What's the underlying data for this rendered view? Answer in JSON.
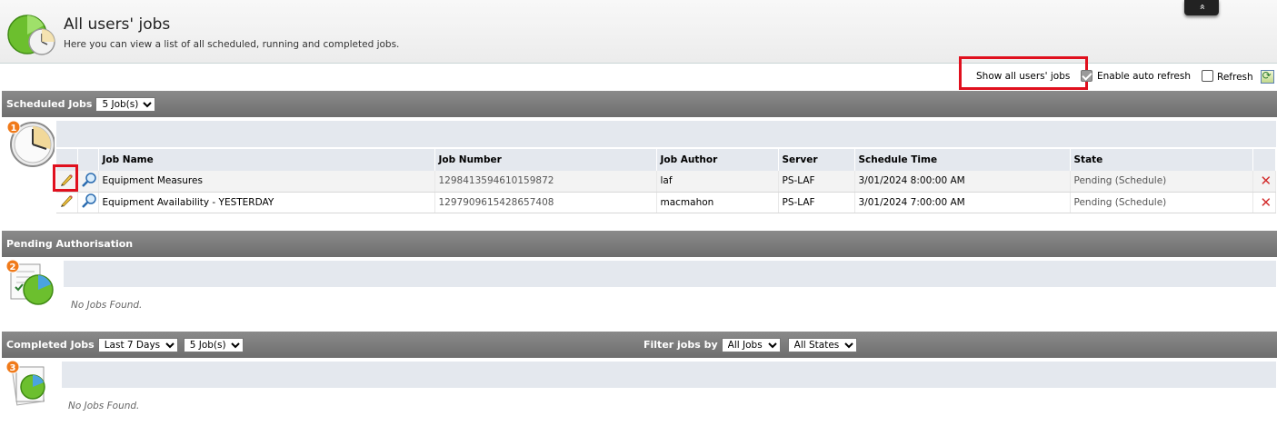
{
  "header": {
    "title": "All users' jobs",
    "subtitle": "Here you can view a list of all scheduled, running and completed jobs.",
    "collapse_label": "»"
  },
  "options": {
    "show_all_label": "Show all users' jobs",
    "show_all_checked": true,
    "auto_refresh_label": "Enable auto refresh",
    "auto_refresh_checked": false,
    "refresh_label": "Refresh"
  },
  "scheduled": {
    "title": "Scheduled Jobs",
    "count_select": "5 Job(s)",
    "badge": "1",
    "columns": [
      "Job Name",
      "Job Number",
      "Job Author",
      "Server",
      "Schedule Time",
      "State"
    ],
    "rows": [
      {
        "name": "Equipment Measures",
        "number": "1298413594610159872",
        "author": "laf",
        "server": "PS-LAF",
        "time": "3/01/2024 8:00:00 AM",
        "state": "Pending (Schedule)"
      },
      {
        "name": "Equipment Availability - YESTERDAY",
        "number": "1297909615428657408",
        "author": "macmahon",
        "server": "PS-LAF",
        "time": "3/01/2024 7:00:00 AM",
        "state": "Pending (Schedule)"
      }
    ],
    "delete_symbol": "✕"
  },
  "pending": {
    "title": "Pending Authorisation",
    "badge": "2",
    "empty": "No Jobs Found."
  },
  "completed": {
    "title": "Completed Jobs",
    "range_select": "Last 7 Days",
    "count_select": "5 Job(s)",
    "filter_label": "Filter jobs by",
    "filter_jobs_select": "All Jobs",
    "filter_states_select": "All States",
    "badge": "3",
    "empty": "No Jobs Found."
  },
  "colors": {
    "highlight": "#e0101e",
    "section_bar": "#7a7a7a",
    "header_strip": "#e4e8ee",
    "badge": "#f07a1a"
  }
}
